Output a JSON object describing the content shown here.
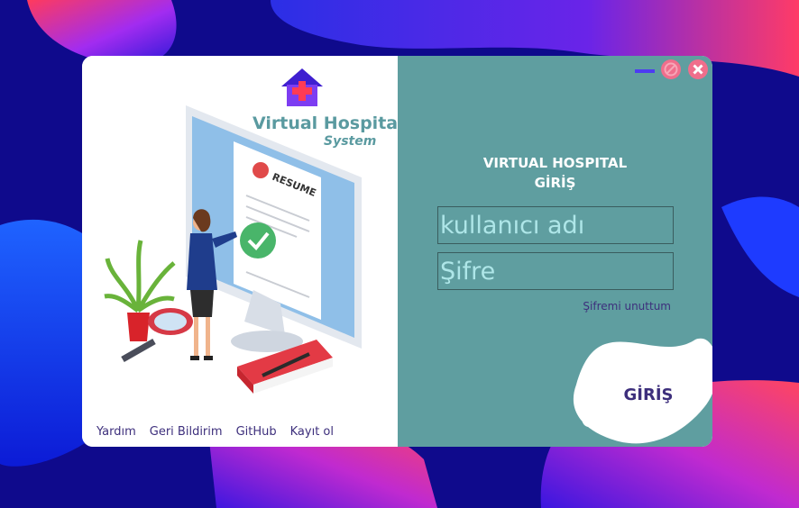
{
  "brand": {
    "title": "Virtual Hospital",
    "subtitle": "System",
    "resume_text": "RESUME"
  },
  "footer": {
    "links": [
      "Yardım",
      "Geri Bildirim",
      "GitHub",
      "Kayıt ol"
    ]
  },
  "login": {
    "heading_line1": "VIRTUAL HOSPITAL",
    "heading_line2": "GİRİŞ",
    "username_placeholder": "kullanıcı adı",
    "password_placeholder": "Şifre",
    "forgot_label": "Şifremi unuttum",
    "submit_label": "GİRİŞ"
  },
  "window_controls": [
    "minimize-icon",
    "block-icon",
    "close-icon"
  ],
  "colors": {
    "panel_teal": "#5f9ea0",
    "accent_purple": "#3d2f7c",
    "control_pink": "#f06e8c",
    "minimize_blue": "#4d3bf2",
    "background_navy": "#0f0a8c"
  }
}
